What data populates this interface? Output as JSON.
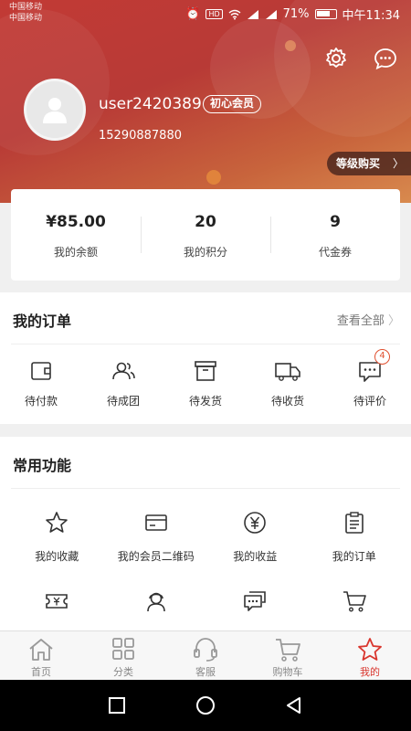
{
  "status_bar": {
    "carrier_1": "中国移动",
    "carrier_2": "中国移动",
    "battery": "71%",
    "time": "中午11:34",
    "hd_label": "HD"
  },
  "profile": {
    "username": "user2420389",
    "member_level": "初心会员",
    "phone": "15290887880",
    "level_purchase_label": "等级购买",
    "level_purchase_chevron": "〉"
  },
  "stats": [
    {
      "value": "¥85.00",
      "label": "我的余额"
    },
    {
      "value": "20",
      "label": "我的积分"
    },
    {
      "value": "9",
      "label": "代金券"
    }
  ],
  "orders": {
    "title": "我的订单",
    "view_all": "查看全部",
    "items": [
      {
        "label": "待付款",
        "icon": "wallet-icon"
      },
      {
        "label": "待成团",
        "icon": "group-icon"
      },
      {
        "label": "待发货",
        "icon": "box-icon"
      },
      {
        "label": "待收货",
        "icon": "truck-icon"
      },
      {
        "label": "待评价",
        "icon": "comment-icon",
        "badge": "4"
      }
    ]
  },
  "common": {
    "title": "常用功能",
    "items": [
      {
        "label": "我的收藏",
        "icon": "star-icon"
      },
      {
        "label": "我的会员二维码",
        "icon": "card-icon"
      },
      {
        "label": "我的收益",
        "icon": "yuan-icon"
      },
      {
        "label": "我的订单",
        "icon": "clipboard-icon"
      },
      {
        "label": "",
        "icon": "ticket-icon"
      },
      {
        "label": "",
        "icon": "support-person-icon"
      },
      {
        "label": "",
        "icon": "chat-icon"
      },
      {
        "label": "",
        "icon": "cart-icon"
      }
    ]
  },
  "tabbar": [
    {
      "label": "首页",
      "icon": "home-icon",
      "active": false
    },
    {
      "label": "分类",
      "icon": "grid-icon",
      "active": false
    },
    {
      "label": "客服",
      "icon": "headset-icon",
      "active": false
    },
    {
      "label": "购物车",
      "icon": "cart-icon",
      "active": false
    },
    {
      "label": "我的",
      "icon": "star-icon",
      "active": true
    }
  ],
  "colors": {
    "header": "#c23a35",
    "accent": "#d9362e",
    "badge": "#e05030"
  }
}
